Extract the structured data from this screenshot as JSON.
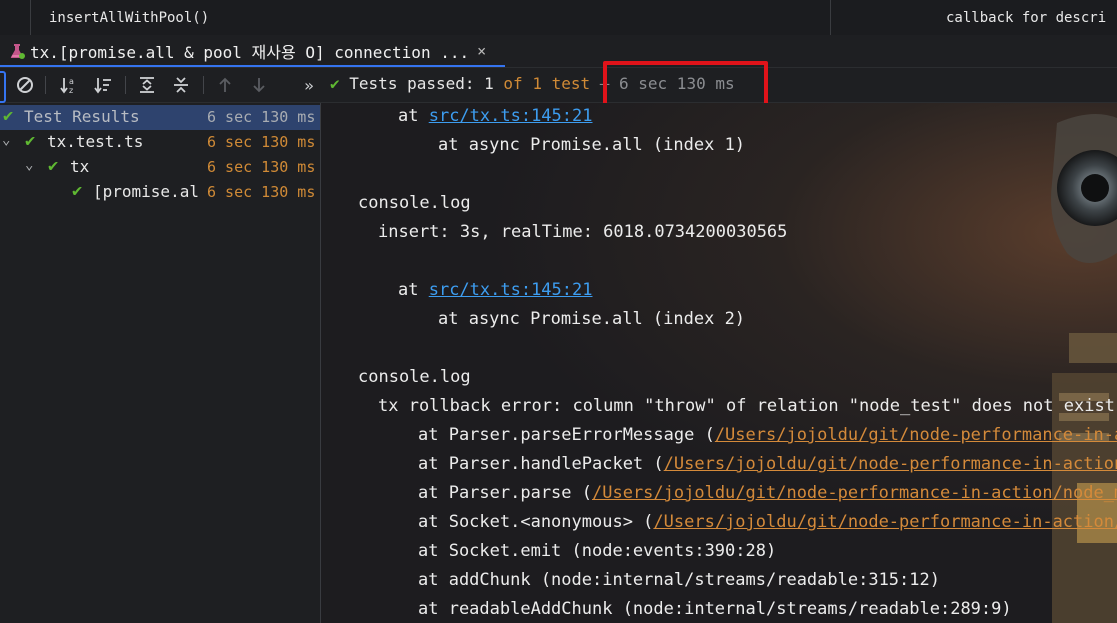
{
  "breadcrumbs": {
    "left": "insertAllWithPool()",
    "right": "callback for descri"
  },
  "tab": {
    "label": "tx.[promise.all & pool 재사용 O] connection ...",
    "close": "×"
  },
  "toolbar": {
    "more": "»",
    "status_check": "✔",
    "status_prefix": "Tests passed: ",
    "passed_count": "1",
    "of_text": " of 1 test",
    "duration": " – 6 sec 130 ms"
  },
  "tree": {
    "rows": [
      {
        "label": "Test Results",
        "time": "6 sec 130 ms"
      },
      {
        "label": "tx.test.ts",
        "time": "6 sec 130 ms"
      },
      {
        "label": "tx",
        "time": "6 sec 130 ms"
      },
      {
        "label": "[promise.al",
        "time": "6 sec 130 ms"
      }
    ]
  },
  "console": {
    "l1_at": "at ",
    "l1_link": "src/tx.ts:145:21",
    "l2": "at async Promise.all (index 1)",
    "l3": "console.log",
    "l4": "insert: 3s, realTime: 6018.0734200030565",
    "l5_at": "at ",
    "l5_link": "src/tx.ts:145:21",
    "l6": "at async Promise.all (index 2)",
    "l7": "console.log",
    "l8": "tx rollback error: column \"throw\" of relation \"node_test\" does not exist",
    "l9_pre": "at Parser.parseErrorMessage (",
    "l9_link": "/Users/jojoldu/git/node-performance-in-ac",
    "l10_pre": "at Parser.handlePacket (",
    "l10_link": "/Users/jojoldu/git/node-performance-in-action/",
    "l11_pre": "at Parser.parse (",
    "l11_link": "/Users/jojoldu/git/node-performance-in-action/node_mo",
    "l12_pre": "at Socket.<anonymous> (",
    "l12_link": "/Users/jojoldu/git/node-performance-in-action/n",
    "l13": "at Socket.emit (node:events:390:28)",
    "l14": "at addChunk (node:internal/streams/readable:315:12)",
    "l15": "at readableAddChunk (node:internal/streams/readable:289:9)"
  },
  "colors": {
    "pass_green": "#5fb832",
    "time_orange": "#d08a36",
    "link_blue": "#3d9df0",
    "highlight_red": "#e0131a",
    "selection_blue": "#2e436e"
  }
}
